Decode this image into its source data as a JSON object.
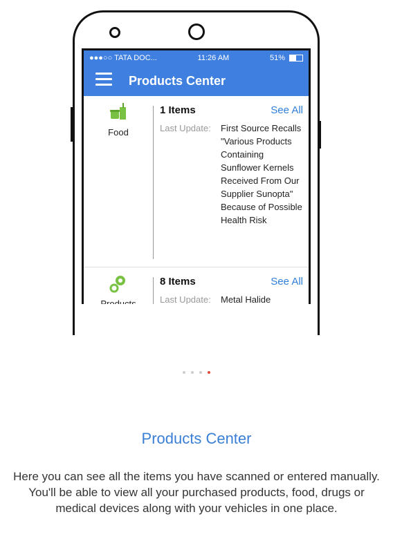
{
  "statusbar": {
    "carrier": "●●●○○ TATA DOC...",
    "time": "11:26 AM",
    "battery": "51%"
  },
  "appbar": {
    "title": "Products Center"
  },
  "items": [
    {
      "category": "Food",
      "count": "1 Items",
      "see_all": "See All",
      "update_label": "Last Update:",
      "update_value": "First Source Recalls \"Various Products Containing Sunflower Kernels Received From Our Supplier Sunopta\" Because of Possible Health Risk"
    },
    {
      "category": "Products",
      "count": "8 Items",
      "see_all": "See All",
      "update_label": "Last Update:",
      "update_value": "Metal Halide"
    }
  ],
  "pager": {
    "total": 4,
    "active": 4
  },
  "onboarding": {
    "title": "Products Center",
    "description": "Here you can see all the items you have scanned or entered manually. You'll be able to view all your purchased products, food, drugs or medical devices along with your vehicles in one place."
  },
  "colors": {
    "accent": "#3f7fe0",
    "link": "#2f7fd8",
    "food_icon": "#79c143",
    "products_icon": "#79c143",
    "dot_active": "#e14b3b"
  }
}
